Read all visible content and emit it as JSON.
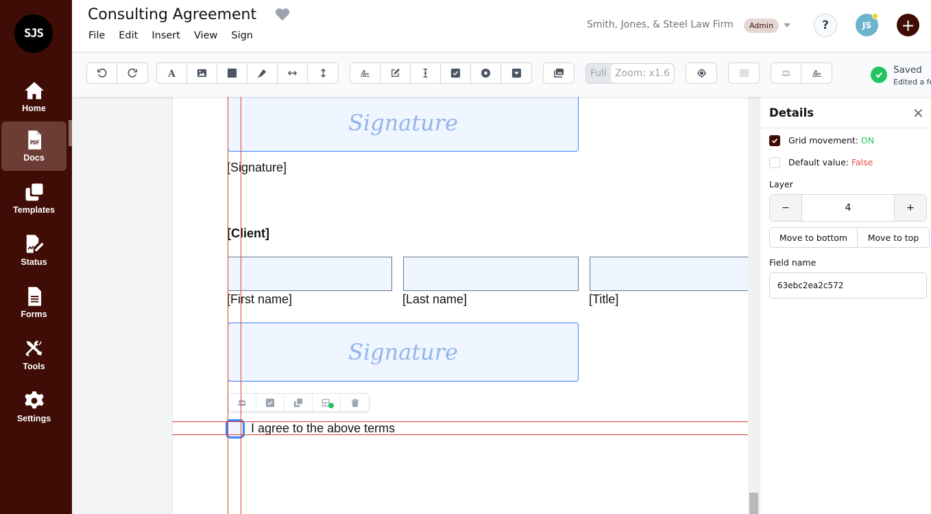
{
  "sidebar": {
    "logo_text": "SJS",
    "items": [
      {
        "label": "Home",
        "icon": "home-icon",
        "active": false
      },
      {
        "label": "Docs",
        "icon": "pdf-file-icon",
        "active": true
      },
      {
        "label": "Templates",
        "icon": "copy-icon",
        "active": false
      },
      {
        "label": "Status",
        "icon": "signature-edit-icon",
        "active": false
      },
      {
        "label": "Forms",
        "icon": "file-lines-icon",
        "active": false
      },
      {
        "label": "Tools",
        "icon": "tools-icon",
        "active": false
      },
      {
        "label": "Settings",
        "icon": "gear-icon",
        "active": false
      }
    ]
  },
  "header": {
    "title": "Consulting Agreement",
    "menu": [
      "File",
      "Edit",
      "Insert",
      "View",
      "Sign"
    ],
    "organization": "Smith, Jones, & Steel Law Firm",
    "role_badge": "Admin",
    "help_label": "?",
    "avatar_initials": "JS",
    "add_label": "+"
  },
  "toolbar": {
    "zoom_full_label": "Full",
    "zoom_level_label": "Zoom: x1.6",
    "save_status": "Saved",
    "save_sub": "Edited a few seconds ago"
  },
  "document": {
    "signature_placeholder": "Signature",
    "signature_label_1": "[Signature]",
    "client_heading": "[Client]",
    "first_name_label": "[First name]",
    "last_name_label": "[Last name]",
    "title_label": "[Title]",
    "agree_text": "I agree to the above terms"
  },
  "details_panel": {
    "title": "Details",
    "grid_movement_label": "Grid movement: ",
    "grid_movement_value": "ON",
    "grid_movement_checked": true,
    "default_value_label": "Default value: ",
    "default_value_value": "False",
    "default_value_checked": false,
    "layer_label": "Layer",
    "layer_value": "4",
    "layer_decrement": "−",
    "layer_increment": "+",
    "move_to_bottom": "Move to bottom",
    "move_to_top": "Move to top",
    "field_name_label": "Field name",
    "field_name_value": "63ebc2ea2c572"
  },
  "colors": {
    "brand": "#3f0d05",
    "success": "#22c55e",
    "danger": "#ef4444",
    "field_border": "#3b82f6",
    "guide": "#e53935"
  }
}
